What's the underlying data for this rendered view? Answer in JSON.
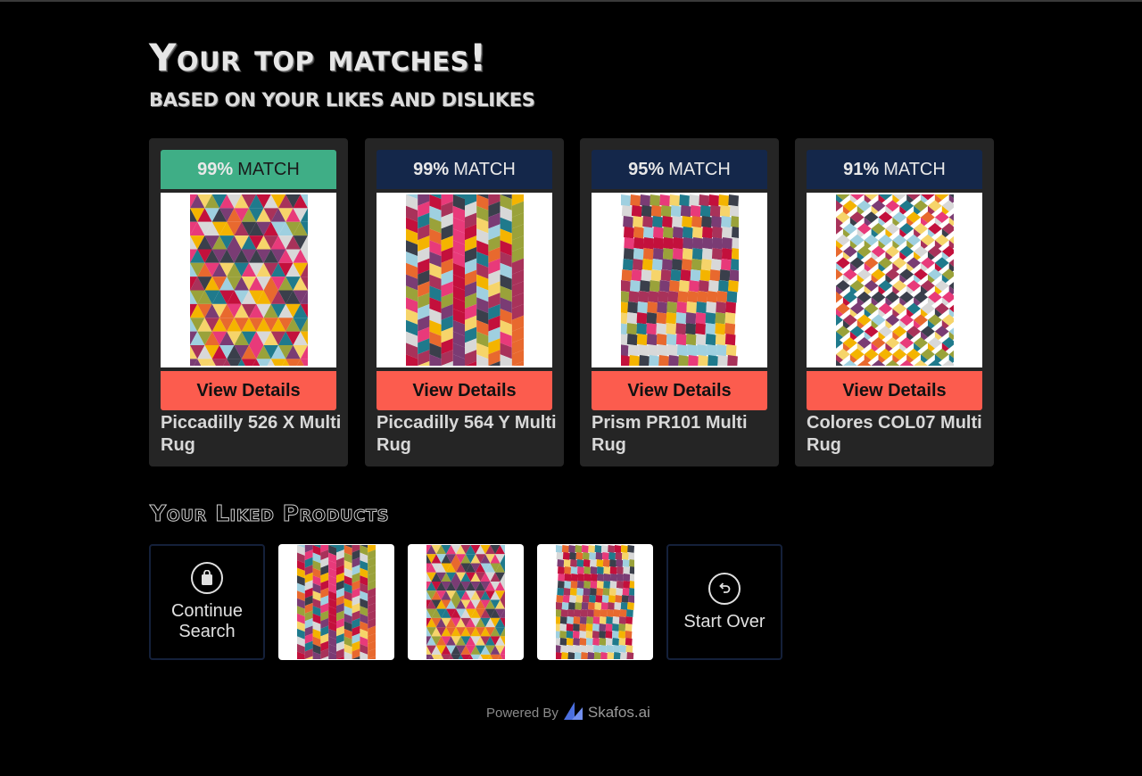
{
  "header": {
    "title": "Your top matches!",
    "subtitle": "BASED ON YOUR LIKES AND DISLIKES"
  },
  "matches": [
    {
      "pct": "99%",
      "label": "MATCH",
      "button": "View Details",
      "name": "Piccadilly 526 X Multi Rug",
      "pattern": "triangles"
    },
    {
      "pct": "99%",
      "label": "MATCH",
      "button": "View Details",
      "name": "Piccadilly 564 Y Multi Rug",
      "pattern": "chevron"
    },
    {
      "pct": "95%",
      "label": "MATCH",
      "button": "View Details",
      "name": "Prism PR101 Multi Rug",
      "pattern": "checker"
    },
    {
      "pct": "91%",
      "label": "MATCH",
      "button": "View Details",
      "name": "Colores COL07 Multi Rug",
      "pattern": "diamonds"
    }
  ],
  "liked": {
    "heading": "Your Liked Products",
    "continue_label": "Continue Search",
    "continue_icon": "bag-icon",
    "start_over_label": "Start Over",
    "start_over_icon": "undo-icon",
    "items": [
      "chevron",
      "triangles",
      "checker"
    ]
  },
  "footer": {
    "powered_by": "Powered By",
    "brand": "Skafos.ai"
  },
  "colors": {
    "top_badge": "#3fae86",
    "badge": "#14274a",
    "button": "#fc5c4e",
    "card": "#252525",
    "background": "#000000"
  }
}
